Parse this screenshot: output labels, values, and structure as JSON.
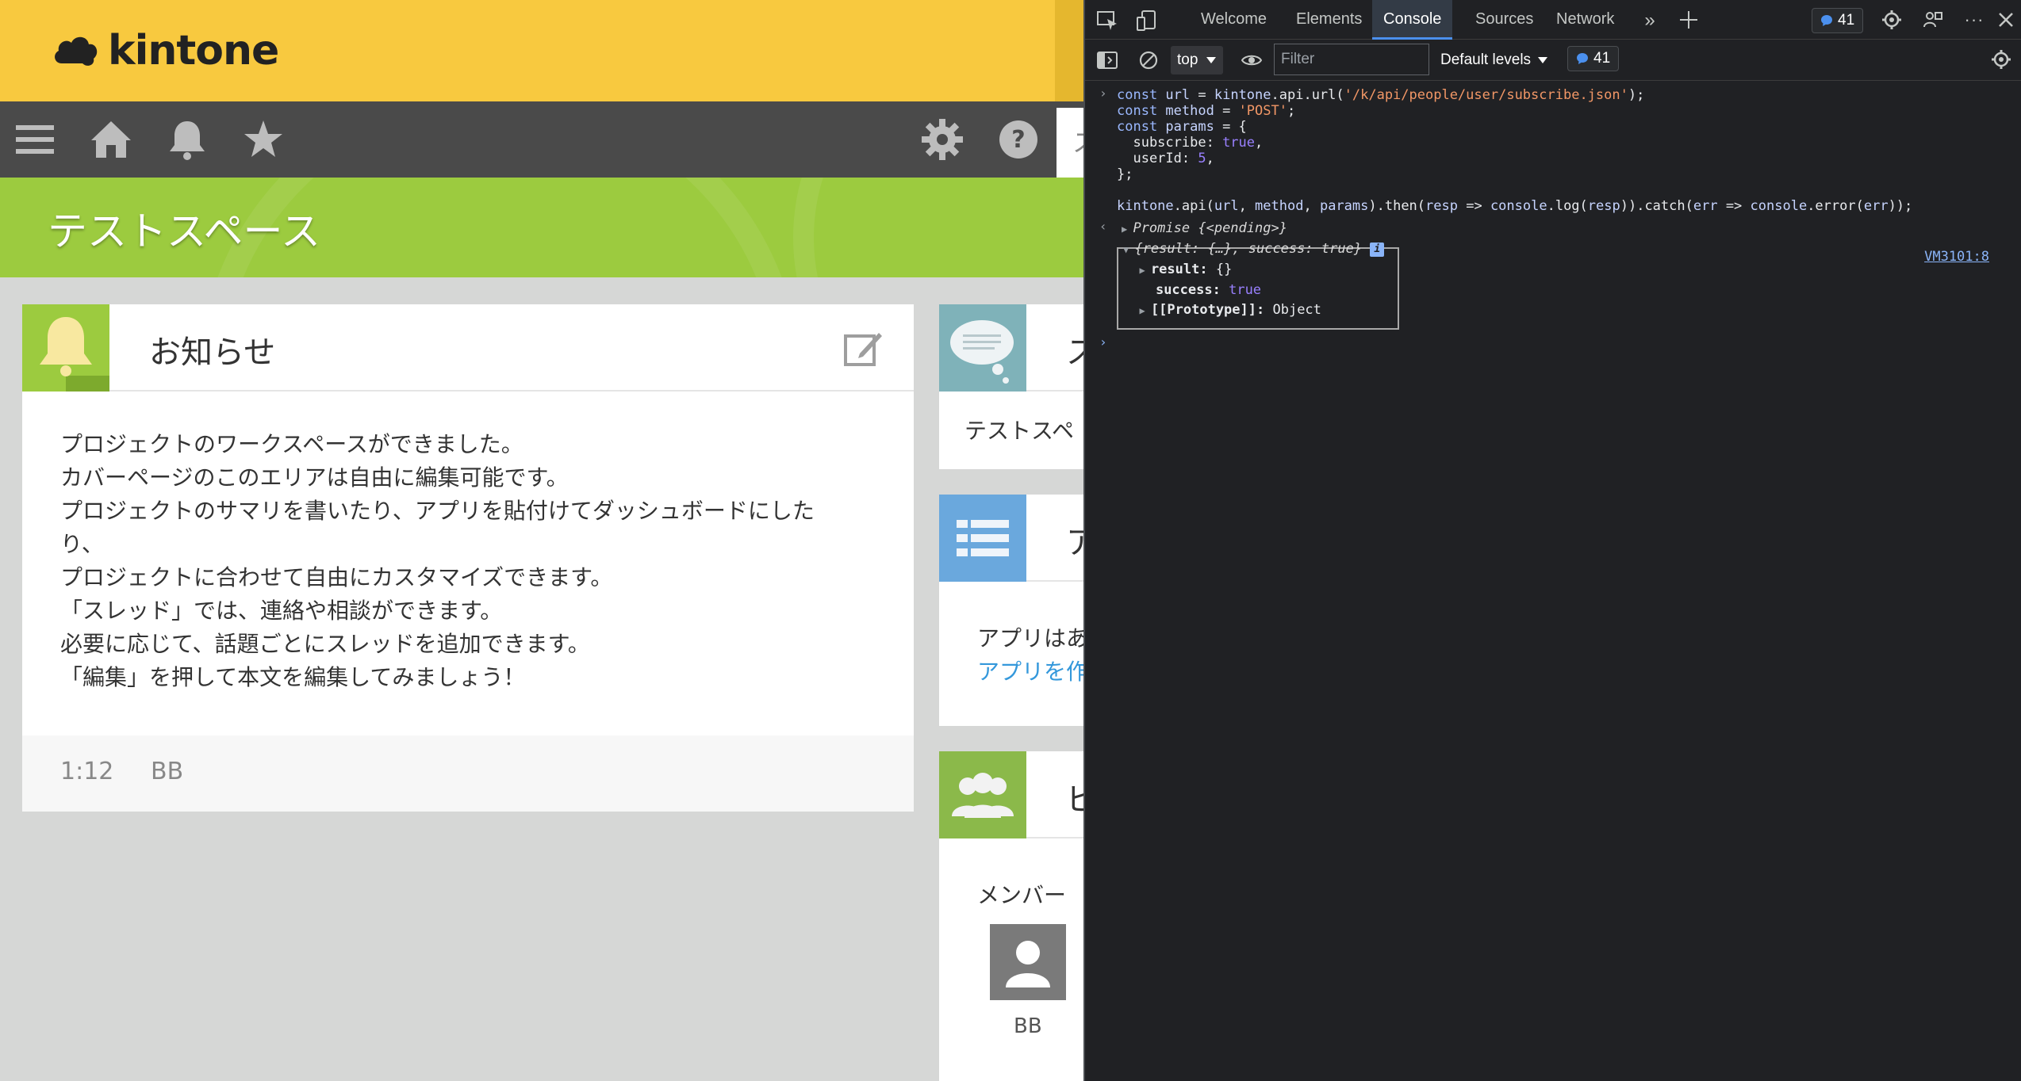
{
  "kintone": {
    "logo_text": "kintone",
    "space_title": "テストスペース",
    "search_stub": "ス",
    "notice": {
      "title": "お知らせ",
      "body_lines": [
        "プロジェクトのワークスペースができました。",
        "カバーページのこのエリアは自由に編集可能です。",
        "プロジェクトのサマリを書いたり、アプリを貼付けてダッシュボードにした",
        "り、",
        "プロジェクトに合わせて自由にカスタマイズできます。",
        "「スレッド」では、連絡や相談ができます。",
        "必要に応じて、話題ごとにスレッドを追加できます。",
        "「編集」を押して本文を編集してみましょう！"
      ],
      "footer_time": "1:12",
      "footer_user": "BB"
    },
    "thread_panel": {
      "title": "ス",
      "text": "テストスペ"
    },
    "apps_panel": {
      "title": "ア",
      "text": "アプリはあ",
      "link": "アプリを作"
    },
    "members_panel": {
      "title": "ピ",
      "label": "メンバー",
      "member_name": "BB"
    }
  },
  "devtools": {
    "tabs": [
      "Welcome",
      "Elements",
      "Console",
      "Sources",
      "Network"
    ],
    "active_tab": "Console",
    "issue_count": "41",
    "context": "top",
    "filter_placeholder": "Filter",
    "levels": "Default levels",
    "code_lines": {
      "l1a": "const ",
      "l1b": "url",
      "l1c": " = ",
      "l1d": "kintone",
      "l1e": ".api.url(",
      "l1f": "'/k/api/people/user/subscribe.json'",
      "l1g": ");",
      "l2a": "const ",
      "l2b": "method",
      "l2c": " = ",
      "l2d": "'POST'",
      "l2e": ";",
      "l3a": "const ",
      "l3b": "params",
      "l3c": " = {",
      "l4a": "  subscribe: ",
      "l4b": "true",
      "l4c": ",",
      "l5a": "  userId: ",
      "l5b": "5",
      "l5c": ",",
      "l6": "};",
      "l7a": "kintone",
      "l7b": ".api(",
      "l7c": "url",
      "l7d": ", ",
      "l7e": "method",
      "l7f": ", ",
      "l7g": "params",
      "l7h": ").then(",
      "l7i": "resp",
      "l7j": " => ",
      "l7k": "console",
      "l7l": ".log(",
      "l7m": "resp",
      "l7n": ")).catch(",
      "l7o": "err",
      "l7p": " => ",
      "l7q": "console",
      "l7r": ".error(",
      "l7s": "err",
      "l7t": "));"
    },
    "promise_label": "Promise",
    "promise_state": "{<pending>}",
    "result_summary_a": "{result: {…}, success: ",
    "result_summary_b": "true",
    "result_summary_c": "}",
    "result_key": "result",
    "result_val": "{}",
    "success_key": "success",
    "success_val": "true",
    "proto_key": "[[Prototype]]",
    "proto_val": "Object",
    "source_link": "VM3101:8"
  }
}
